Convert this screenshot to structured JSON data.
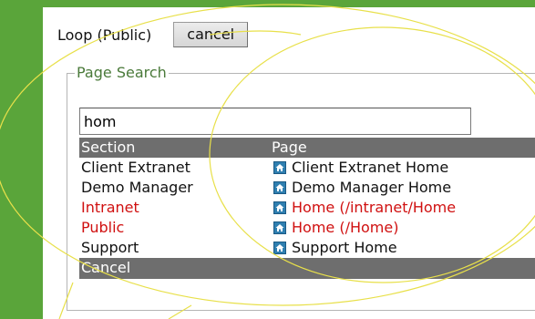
{
  "header": {
    "title": "Loop (Public)",
    "cancel_label": "cancel"
  },
  "search": {
    "legend": "Page Search",
    "value": "hom"
  },
  "results": {
    "columns": {
      "section": "Section",
      "page": "Page"
    },
    "rows": [
      {
        "section": "Client Extranet",
        "page": "Client Extranet Home"
      },
      {
        "section": "Demo Manager",
        "page": "Demo Manager Home"
      },
      {
        "section": "Intranet",
        "page": "Home  (/intranet/Home"
      },
      {
        "section": "Public",
        "page": "Home  (/Home)"
      },
      {
        "section": "Support",
        "page": "Support Home"
      }
    ],
    "footer_label": "Cancel"
  },
  "colors": {
    "background": "#5aa53a",
    "header_bg": "#6e6e6e",
    "highlight_text": "#d01010",
    "legend_text": "#4a7a3a",
    "annotation": "#e8e04a"
  },
  "icons": {
    "page_icon": "home-icon"
  }
}
